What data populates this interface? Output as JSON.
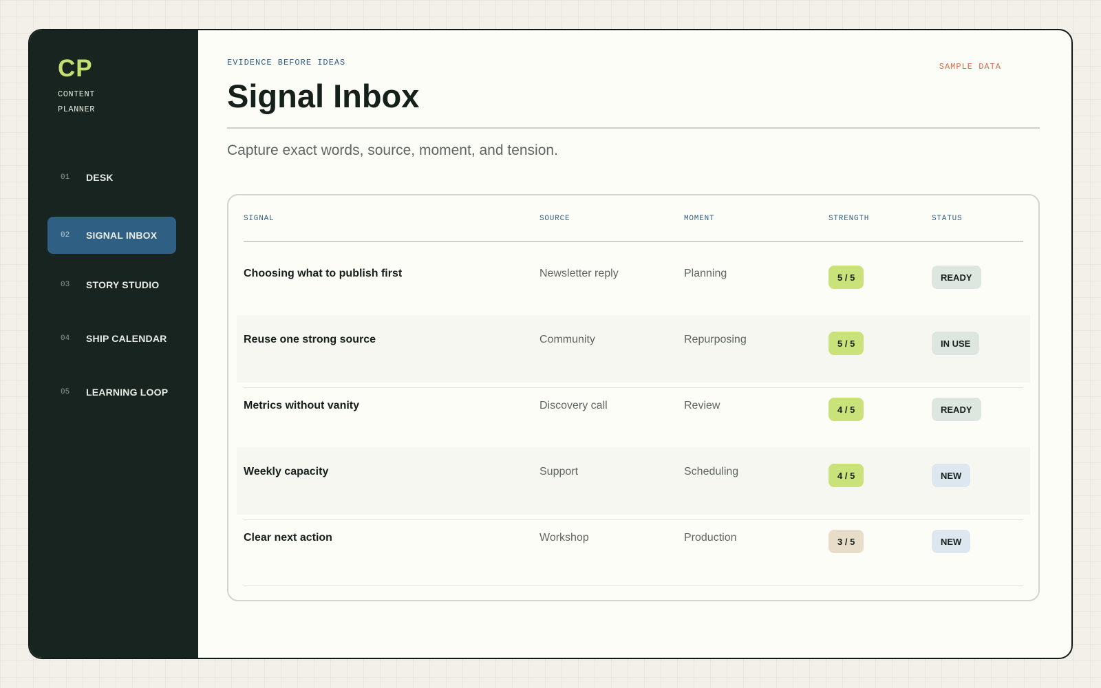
{
  "sidebar": {
    "brand": "CP",
    "brand_sub": "CONTENT PLANNER",
    "items": [
      {
        "num": "01",
        "label": "DESK",
        "active": false
      },
      {
        "num": "02",
        "label": "SIGNAL INBOX",
        "active": true
      },
      {
        "num": "03",
        "label": "STORY STUDIO",
        "active": false
      },
      {
        "num": "04",
        "label": "SHIP CALENDAR",
        "active": false
      },
      {
        "num": "05",
        "label": "LEARNING LOOP",
        "active": false
      }
    ]
  },
  "header": {
    "eyebrow": "EVIDENCE BEFORE IDEAS",
    "title": "Signal Inbox",
    "badge": "SAMPLE DATA",
    "subtitle": "Capture exact words, source, moment, and tension."
  },
  "table": {
    "columns": [
      "SIGNAL",
      "SOURCE",
      "MOMENT",
      "STRENGTH",
      "STATUS"
    ],
    "rows": [
      {
        "signal": "Choosing what to publish first",
        "source": "Newsletter reply",
        "moment": "Planning",
        "strength": "5 / 5",
        "status": "READY"
      },
      {
        "signal": "Reuse one strong source",
        "source": "Community",
        "moment": "Repurposing",
        "strength": "5 / 5",
        "status": "IN USE"
      },
      {
        "signal": "Metrics without vanity",
        "source": "Discovery call",
        "moment": "Review",
        "strength": "4 / 5",
        "status": "READY"
      },
      {
        "signal": "Weekly capacity",
        "source": "Support",
        "moment": "Scheduling",
        "strength": "4 / 5",
        "status": "NEW"
      },
      {
        "signal": "Clear next action",
        "source": "Workshop",
        "moment": "Production",
        "strength": "3 / 5",
        "status": "NEW"
      }
    ]
  },
  "colors": {
    "sidebar_bg": "#17241f",
    "accent_blue": "#2f5f82",
    "accent_lime": "#c5e072",
    "strength_high": "#c9e27a",
    "strength_mid": "#e8ddc9",
    "status_ready": "#dde7df",
    "status_in_use": "#dde7df",
    "status_new": "#dce7ef",
    "sample_badge": "#d96a4a"
  }
}
